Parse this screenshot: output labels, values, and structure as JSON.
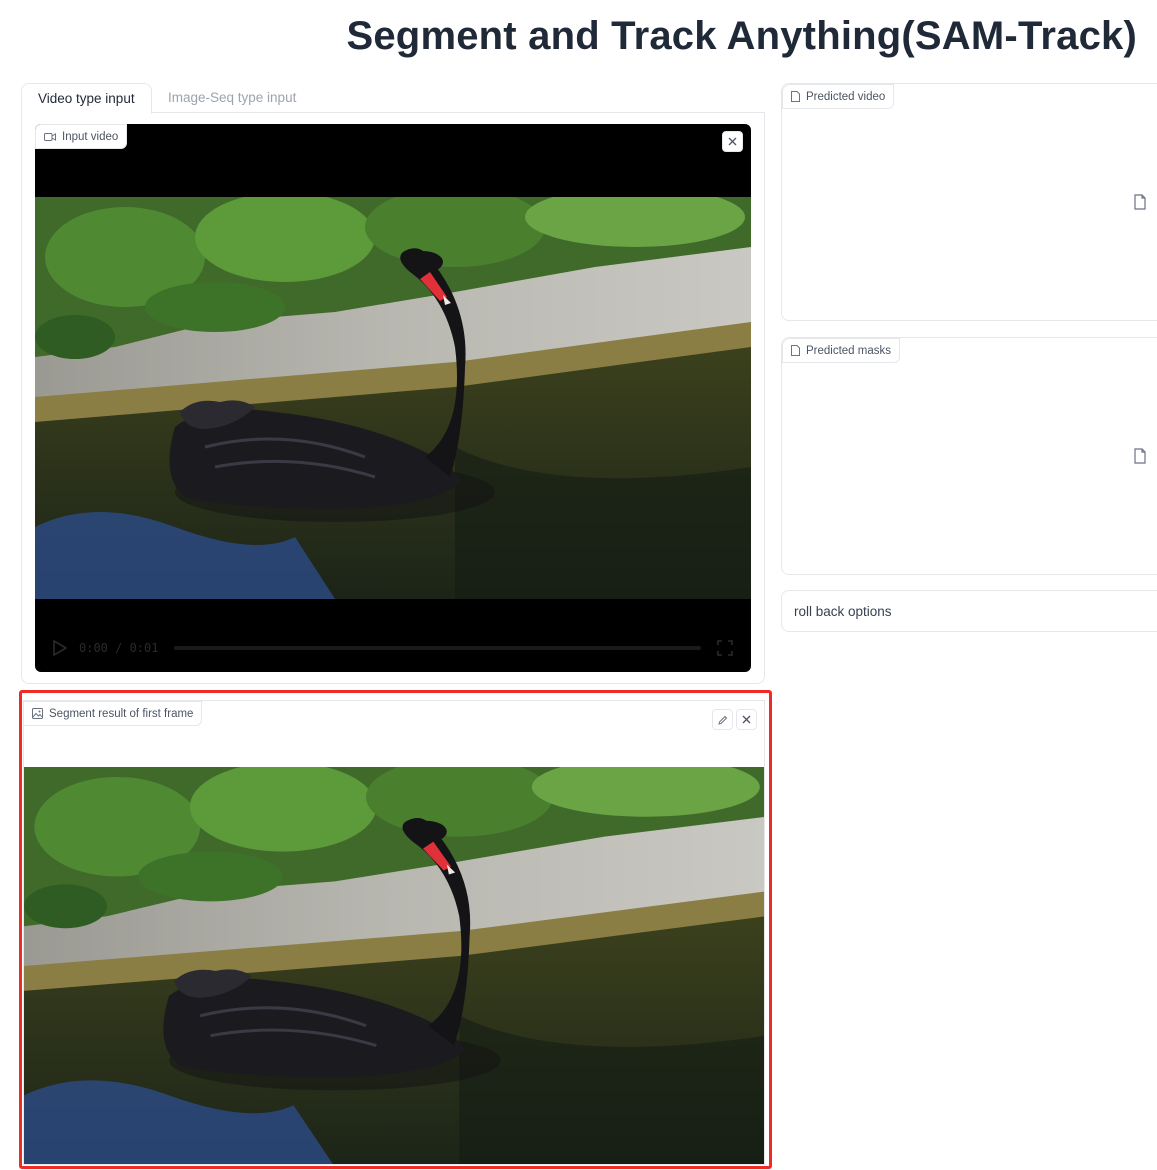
{
  "page": {
    "title": "Segment and Track Anything(SAM-Track)"
  },
  "tabs": [
    {
      "label": "Video type input",
      "active": true
    },
    {
      "label": "Image-Seq type input",
      "active": false
    }
  ],
  "input_video": {
    "label": "Input video",
    "icon": "video-icon",
    "time_display": "0:00 / 0:01",
    "progress": 0.0
  },
  "segment_result": {
    "label": "Segment result of first frame",
    "icon": "image-icon"
  },
  "outputs": {
    "predicted_video": {
      "label": "Predicted video",
      "icon": "file-icon"
    },
    "predicted_masks": {
      "label": "Predicted masks",
      "icon": "file-icon"
    }
  },
  "rollback": {
    "label": "roll back options"
  },
  "colors": {
    "highlight_border": "#ef2b26",
    "border": "#e5e7eb",
    "title": "#1f2937"
  }
}
